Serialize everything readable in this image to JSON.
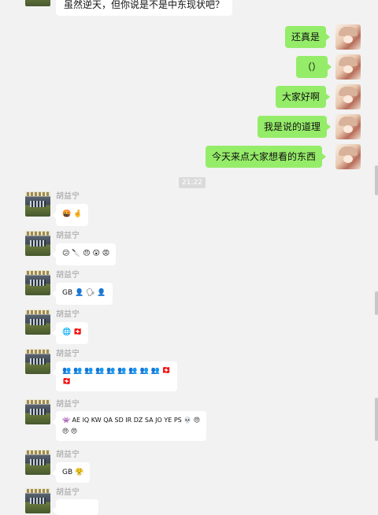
{
  "messages_top": {
    "partial_text": "虽然逆天，但你说是不是中东现状吧？"
  },
  "outgoing": [
    {
      "text": "还真是"
    },
    {
      "text": "（）"
    },
    {
      "text": "大家好啊"
    },
    {
      "text": "我是说的道理"
    },
    {
      "text": "今天来点大家想看的东西"
    }
  ],
  "timestamp": "21:22",
  "sender_name": "胡益宁",
  "incoming": [
    {
      "line1": "🤬 🤞",
      "line2": ""
    },
    {
      "line1": "😕 🔪 😠 😲 😡",
      "line2": ""
    },
    {
      "line1": "GB 👤 🗣 👤",
      "line2": ""
    },
    {
      "line1": "🌐 🇨🇭",
      "line2": ""
    },
    {
      "line1": "👥 👥 👥 👥 👥 👥 👥 👥 👥 🇨🇭",
      "line2": "🇨🇭"
    },
    {
      "line1": "👾 AE IQ KW QA SD IR DZ SA JO YE PS 💀 😠",
      "line2": "😠 😠"
    },
    {
      "line1": "GB 😤",
      "line2": ""
    },
    {
      "line1": "",
      "line2": ""
    }
  ],
  "icons": {
    "right_avatar": "anime-girl-avatar-icon",
    "left_avatar": "pixel-art-avatar-icon"
  }
}
